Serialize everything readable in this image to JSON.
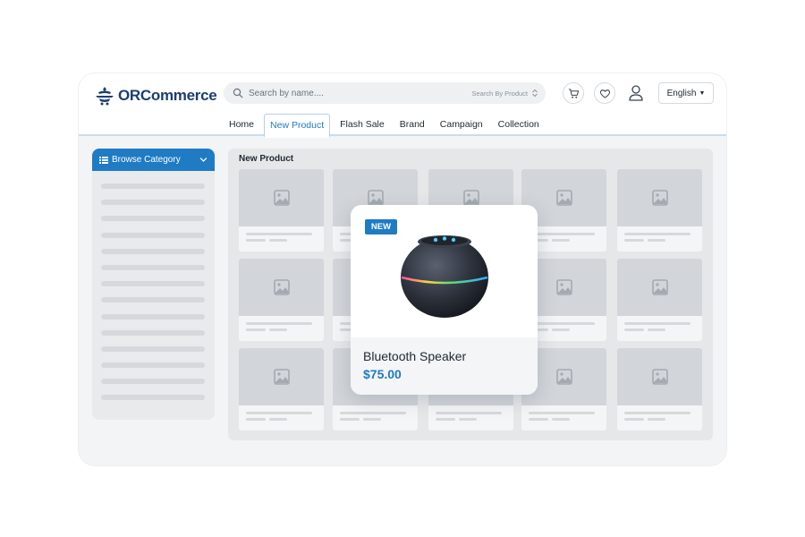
{
  "brand": {
    "name": "ORCommerce",
    "accent": "#1f7bc4",
    "logo_color": "#1c3d74"
  },
  "search": {
    "placeholder": "Search by name....",
    "scope": "Search By Product"
  },
  "header": {
    "language": "English",
    "icons": [
      "cart-icon",
      "heart-icon",
      "user-icon"
    ]
  },
  "nav": {
    "items": [
      "Home",
      "New Product",
      "Flash Sale",
      "Brand",
      "Campaign",
      "Collection"
    ],
    "active": "New Product"
  },
  "sidebar": {
    "button_label": "Browse Category"
  },
  "main": {
    "section_title": "New Product"
  },
  "featured": {
    "badge": "NEW",
    "name": "Bluetooth Speaker",
    "price": "$75.00"
  }
}
